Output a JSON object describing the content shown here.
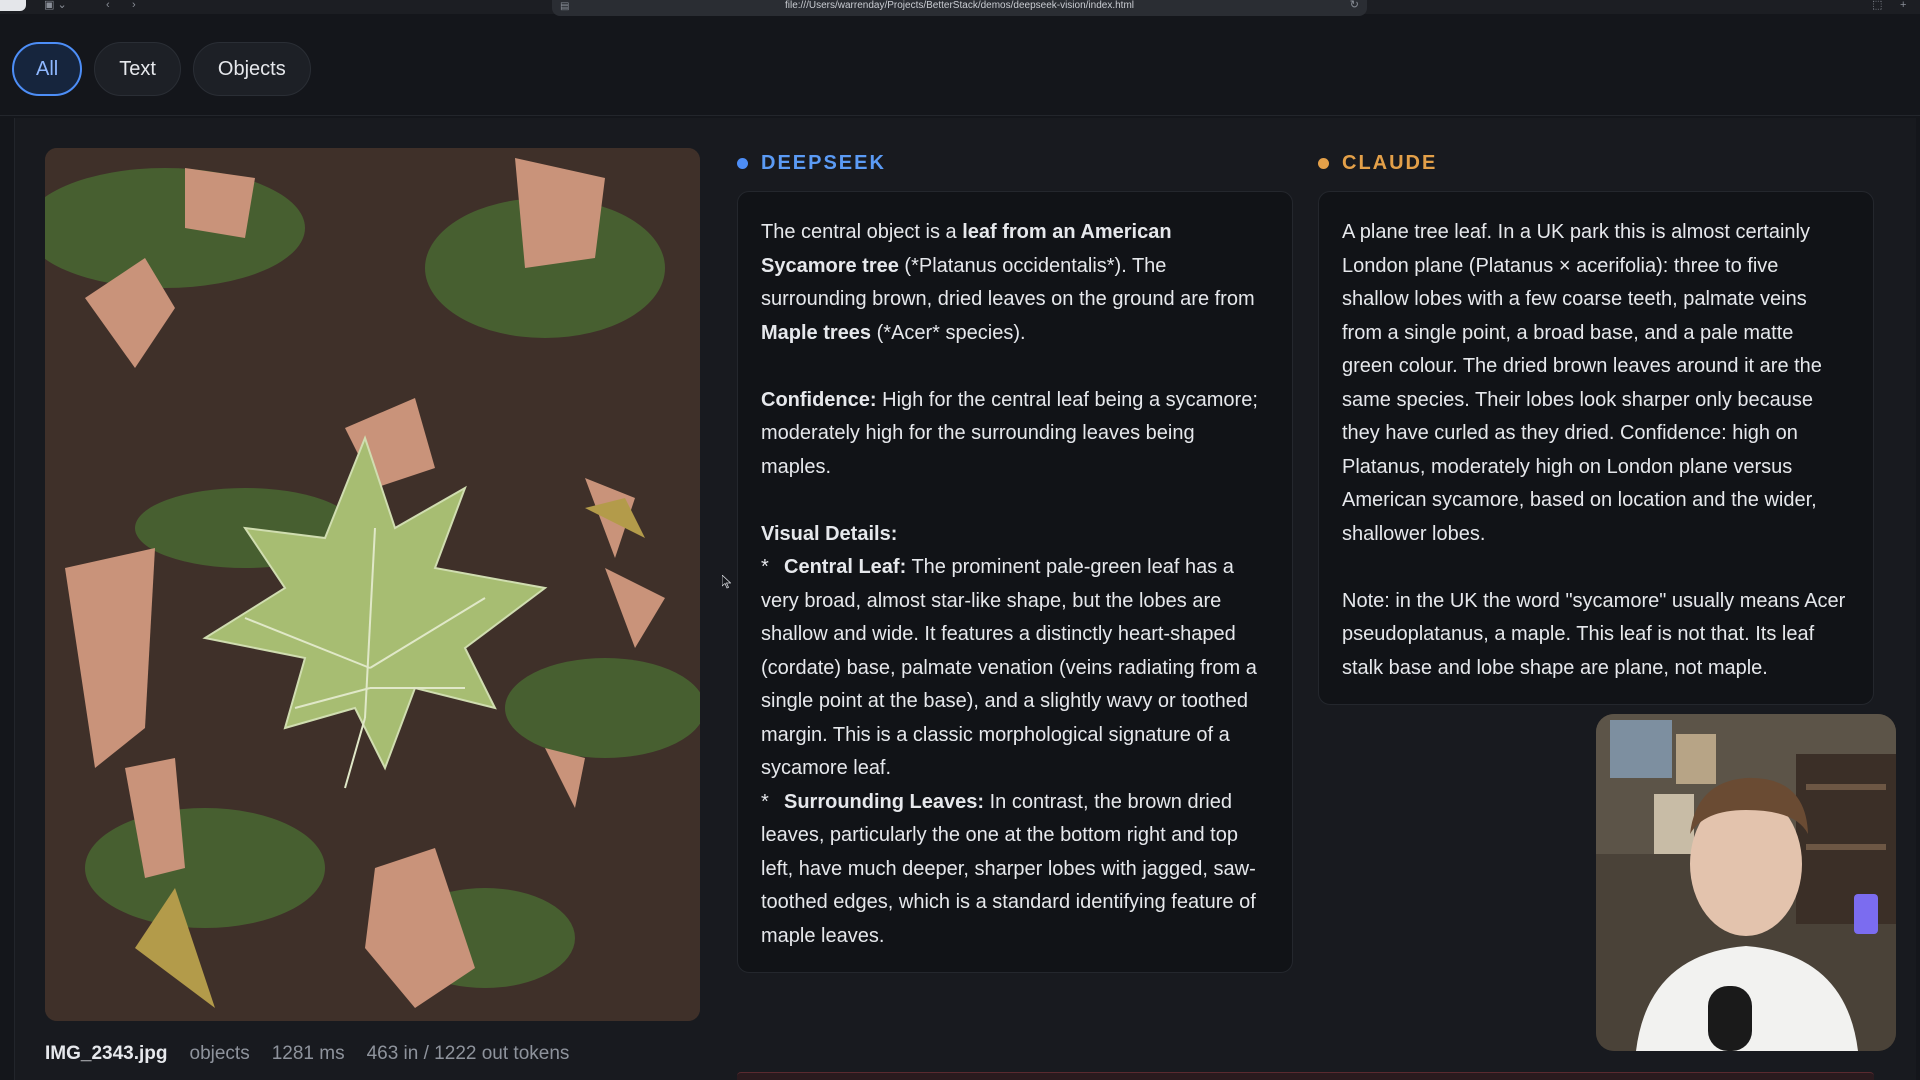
{
  "browser": {
    "url": "file:///Users/warrenday/Projects/BetterStack/demos/deepseek-vision/index.html"
  },
  "filters": [
    {
      "label": "All",
      "active": true
    },
    {
      "label": "Text",
      "active": false
    },
    {
      "label": "Objects",
      "active": false
    }
  ],
  "image": {
    "filename": "IMG_2343.jpg",
    "mode": "objects",
    "latency": "1281 ms",
    "tokens": "463 in / 1222 out tokens"
  },
  "deepseek": {
    "title": "DEEPSEEK",
    "color": "#4d8ef7",
    "p1_a": "The central object is a ",
    "p1_b": "leaf from an American Sycamore tree",
    "p1_c": " (*Platanus occidentalis*). The surrounding brown, dried leaves on the ground are from ",
    "p1_d": "Maple trees",
    "p1_e": " (*Acer* species).",
    "conf_label": "Confidence:",
    "conf_text": " High for the central leaf being a sycamore; moderately high for the surrounding leaves being maples.",
    "details_label": "Visual Details:",
    "bullet_marker": "*",
    "b1_label": "Central Leaf:",
    "b1_text": " The prominent pale-green leaf has a very broad, almost star-like shape, but the lobes are shallow and wide. It features a distinctly heart-shaped (cordate) base, palmate venation (veins radiating from a single point at the base), and a slightly wavy or toothed margin. This is a classic morphological signature of a sycamore leaf.",
    "b2_label": "Surrounding Leaves:",
    "b2_text": " In contrast, the brown dried leaves, particularly the one at the bottom right and top left, have much deeper, sharper lobes with jagged, saw-toothed edges, which is a standard identifying feature of maple leaves."
  },
  "claude": {
    "title": "CLAUDE",
    "color": "#e3a049",
    "p1": "A plane tree leaf. In a UK park this is almost certainly London plane (Platanus × acerifolia): three to five shallow lobes with a few coarse teeth, palmate veins from a single point, a broad base, and a pale matte green colour. The dried brown leaves around it are the same species. Their lobes look sharper only because they have curled as they dried. Confidence: high on Platanus, moderately high on London plane versus American sycamore, based on location and the wider, shallower lobes.",
    "p2": "Note: in the UK the word \"sycamore\" usually means Acer pseudoplatanus, a maple. This leaf is not that. Its leaf stalk base and lobe shape are plane, not maple."
  }
}
